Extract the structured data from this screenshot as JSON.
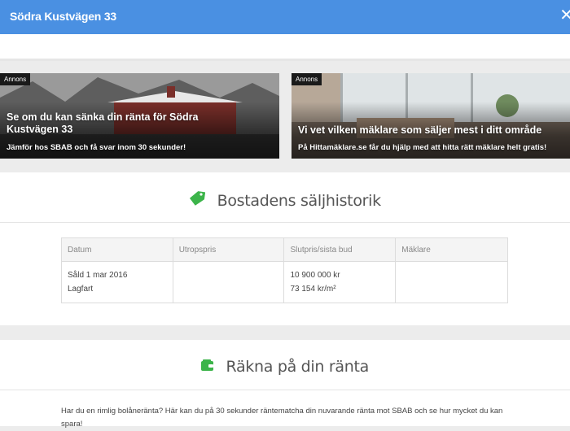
{
  "header": {
    "title": "Södra Kustvägen 33",
    "close_icon": "close-icon",
    "color": "#4a90e2"
  },
  "ads": [
    {
      "badge": "Annons",
      "headline": "Se om du kan sänka din ränta för Södra Kustvägen 33",
      "subline": "Jämför hos SBAB och få svar inom 30 sekunder!"
    },
    {
      "badge": "Annons",
      "headline": "Vi vet vilken mäklare som säljer mest i ditt område",
      "subline": "På Hittamäklare.se får du hjälp med att hitta rätt mäklare helt gratis!"
    }
  ],
  "history": {
    "title": "Bostadens säljhistorik",
    "icon": "price-tag-icon",
    "columns": [
      "Datum",
      "Utropspris",
      "Slutpris/sista bud",
      "Mäklare"
    ],
    "rows": [
      {
        "date": "Såld 1 mar 2016",
        "type": "Lagfart",
        "asking": "",
        "final": "10 900 000 kr",
        "per_sqm": "73 154 kr/m²",
        "broker": ""
      }
    ]
  },
  "rate": {
    "title": "Räkna på din ränta",
    "icon": "wallet-icon",
    "text": "Har du en rimlig bolåneränta? Här kan du på 30 sekunder räntematcha din nuvarande ränta mot SBAB och se hur mycket du kan spara!"
  },
  "colors": {
    "accent_green": "#3cb44a",
    "header_blue": "#4a90e2"
  }
}
